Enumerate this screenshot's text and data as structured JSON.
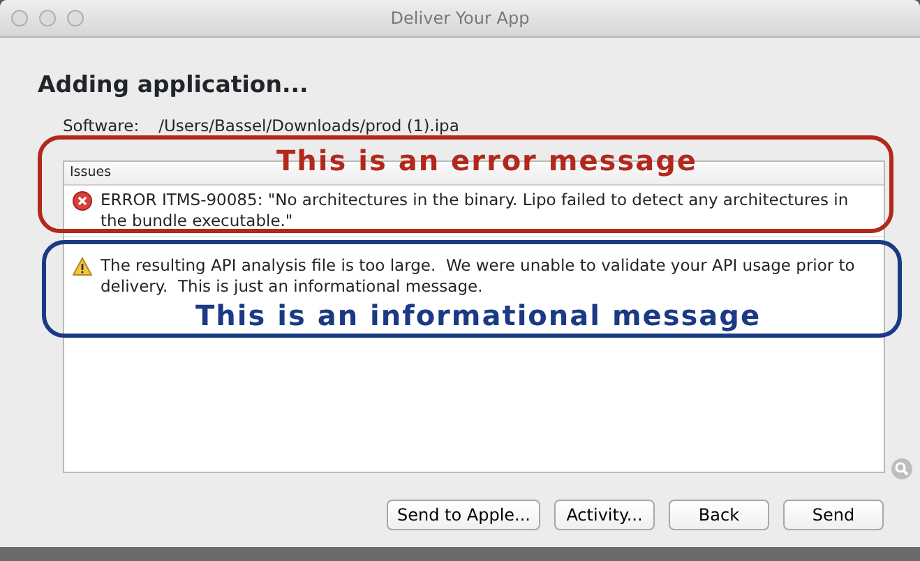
{
  "window": {
    "title": "Deliver Your App"
  },
  "heading": "Adding application...",
  "software": {
    "label": "Software:",
    "value": "/Users/Bassel/Downloads/prod (1).ipa"
  },
  "issues": {
    "header": "Issues",
    "rows": [
      {
        "kind": "error",
        "text": "ERROR ITMS-90085: \"No architectures in the binary. Lipo failed to detect any architectures in the bundle executable.\""
      },
      {
        "kind": "warning",
        "text": "The resulting API analysis file is too large.  We were unable to validate your API usage prior to delivery.  This is just an informational message."
      }
    ]
  },
  "annotations": [
    {
      "kind": "error",
      "text": "This is an error message",
      "color": "#b3281c"
    },
    {
      "kind": "info",
      "text": "This is an informational message",
      "color": "#1b3a85"
    }
  ],
  "buttons": [
    "Send to Apple...",
    "Activity...",
    "Back",
    "Send"
  ]
}
